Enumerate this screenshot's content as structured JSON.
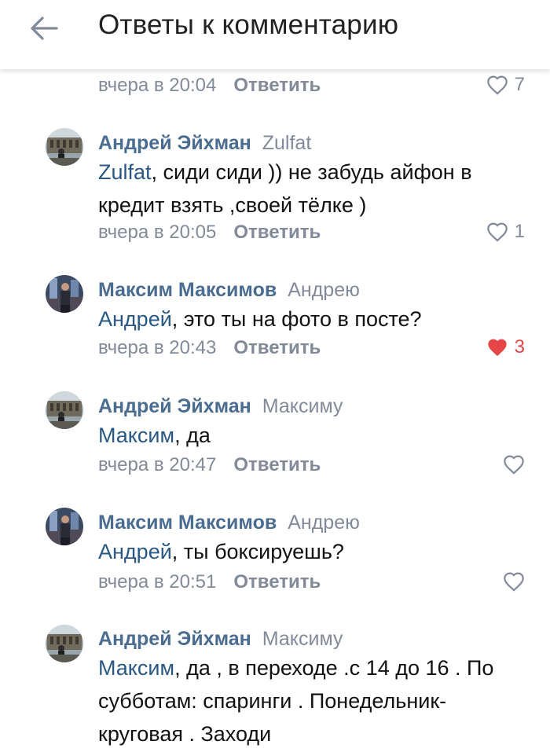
{
  "header": {
    "title": "Ответы к комментарию"
  },
  "top_item": {
    "time": "вчера в 20:04",
    "reply": "Ответить",
    "likes": "7"
  },
  "comments": [
    {
      "author": "Андрей Эйхман",
      "to": "Zulfat",
      "mention": "Zulfat",
      "text": ", сиди сиди )) не забудь айфон в кредит взять ,своей тёлке )",
      "time": "вчера в 20:05",
      "reply": "Ответить",
      "likes": "1",
      "liked": false
    },
    {
      "author": "Максим Максимов",
      "to": "Андрею",
      "mention": "Андрей",
      "text": ", это ты на фото в посте?",
      "time": "вчера в 20:43",
      "reply": "Ответить",
      "likes": "3",
      "liked": true
    },
    {
      "author": "Андрей Эйхман",
      "to": "Максиму",
      "mention": "Максим",
      "text": ", да",
      "time": "вчера в 20:47",
      "reply": "Ответить",
      "likes": "",
      "liked": false
    },
    {
      "author": "Максим Максимов",
      "to": "Андрею",
      "mention": "Андрей",
      "text": ", ты боксируешь?",
      "time": "вчера в 20:51",
      "reply": "Ответить",
      "likes": "",
      "liked": false
    },
    {
      "author": "Андрей Эйхман",
      "to": "Максиму",
      "mention": "Максим",
      "text": ", да , в переходе .с 14 до 16 . По субботам: спаринги . Понедельник- круговая . Заходи",
      "time": "",
      "reply": "",
      "likes": "",
      "liked": false
    }
  ],
  "colors": {
    "name": "#4a6c91",
    "mention": "#2a5885",
    "meta": "#828a99",
    "like_active": "#e64646"
  },
  "icons": {
    "back": "arrow-left-icon",
    "like": "heart-icon",
    "like_active": "heart-filled-icon"
  }
}
